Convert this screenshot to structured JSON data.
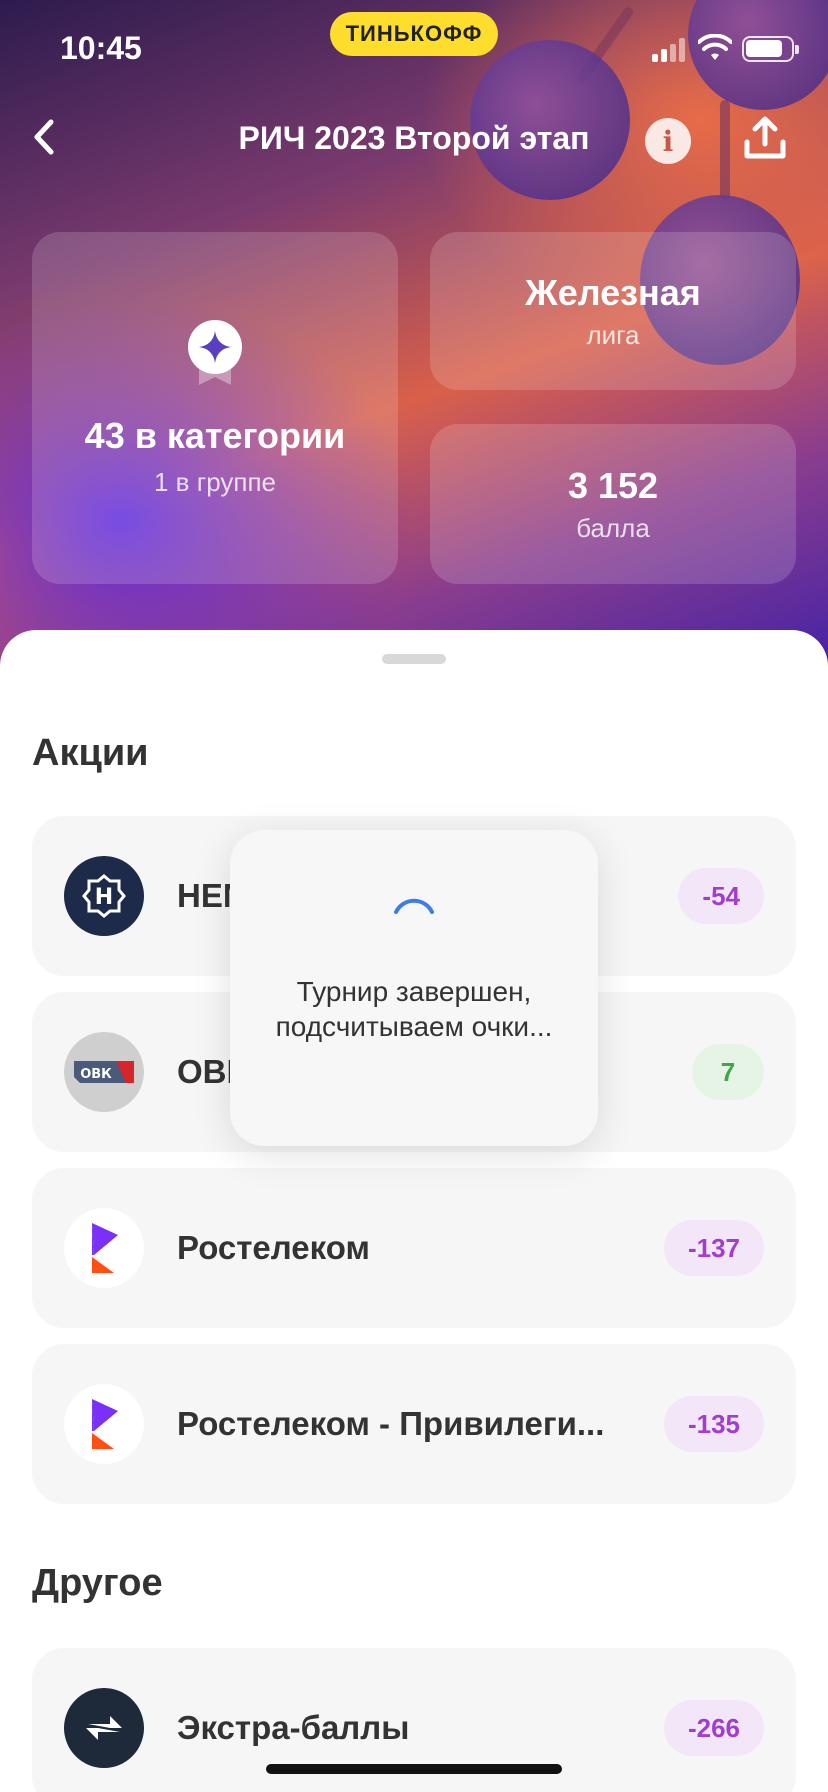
{
  "status_bar": {
    "time": "10:45",
    "brand": "ТИНЬКОФФ"
  },
  "header": {
    "title": "РИЧ 2023 Второй этап"
  },
  "cards": {
    "rank": {
      "value": "43 в категории",
      "sub": "1 в группе"
    },
    "league": {
      "value": "Железная",
      "sub": "лига"
    },
    "points": {
      "value": "3 152",
      "sub": "балла"
    }
  },
  "sections": {
    "stocks": {
      "title": "Акции",
      "items": [
        {
          "name": "HEM",
          "score": "-54"
        },
        {
          "name": "OBI",
          "score": "7"
        },
        {
          "name": "Ростелеком",
          "score": "-137"
        },
        {
          "name": "Ростелеком - Привилеги...",
          "score": "-135"
        }
      ]
    },
    "other": {
      "title": "Другое",
      "items": [
        {
          "name": "Экстра-баллы",
          "score": "-266"
        }
      ]
    }
  },
  "loader": {
    "text": "Турнир завершен, подсчитываем очки..."
  },
  "logos": {
    "hem_letter": "H",
    "obi_text": "ОВК"
  },
  "colors": {
    "brand_yellow": "#ffdd2d",
    "negative_score": "#a23ecf",
    "positive_score": "#3ea74a",
    "rostelecom_purple": "#7b2ff7",
    "rostelecom_orange": "#ff4f12"
  }
}
